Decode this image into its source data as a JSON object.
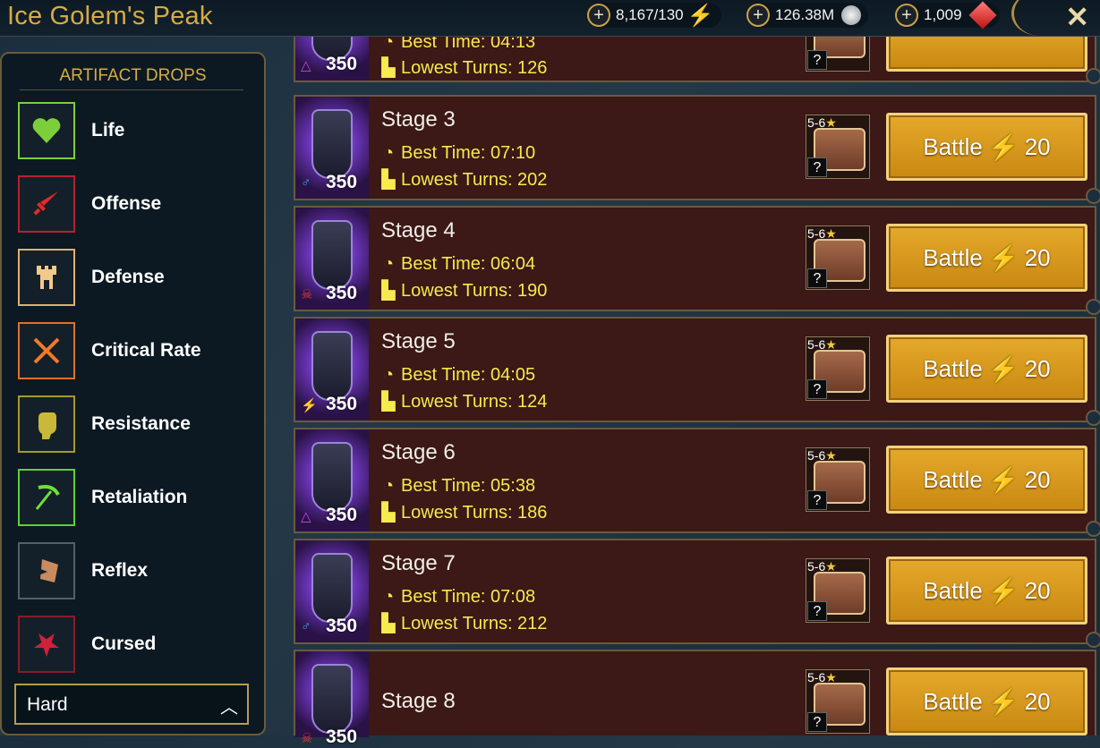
{
  "header": {
    "title": "Ice Golem's Peak",
    "resources": [
      {
        "name": "energy",
        "value": "8,167/130",
        "icon": "lightning-icon"
      },
      {
        "name": "silver",
        "value": "126.38M",
        "icon": "silver-coin-icon"
      },
      {
        "name": "gems",
        "value": "1,009",
        "icon": "ruby-icon"
      }
    ],
    "close_symbol": "✕"
  },
  "panel": {
    "title": "ARTIFACT DROPS",
    "filters": [
      {
        "label": "Life",
        "icon": "heart-icon",
        "color": "#7ccf3b"
      },
      {
        "label": "Offense",
        "icon": "sword-icon",
        "color": "#d23030"
      },
      {
        "label": "Defense",
        "icon": "tower-icon",
        "color": "#f0c57a"
      },
      {
        "label": "Critical Rate",
        "icon": "crossed-swords-icon",
        "color": "#f07a2a"
      },
      {
        "label": "Resistance",
        "icon": "fist-icon",
        "color": "#c9b83a"
      },
      {
        "label": "Retaliation",
        "icon": "scythe-icon",
        "color": "#6fe03a"
      },
      {
        "label": "Reflex",
        "icon": "arrow-shield-icon",
        "color": "#c98a60"
      },
      {
        "label": "Cursed",
        "icon": "pentagram-icon",
        "color": "#d0203a"
      }
    ],
    "difficulty": "Hard"
  },
  "stages": [
    {
      "name": "",
      "level": "350",
      "affinity": "triangle",
      "best_time": "Best Time: 04:13",
      "lowest_turns": "Lowest Turns: 126",
      "chest_rank": "5-6",
      "battle_label": "Battle",
      "battle_cost": "20"
    },
    {
      "name": "Stage 3",
      "level": "350",
      "affinity": "blue",
      "best_time": "Best Time: 07:10",
      "lowest_turns": "Lowest Turns: 202",
      "chest_rank": "5-6",
      "battle_label": "Battle",
      "battle_cost": "20"
    },
    {
      "name": "Stage 4",
      "level": "350",
      "affinity": "red",
      "best_time": "Best Time: 06:04",
      "lowest_turns": "Lowest Turns: 190",
      "chest_rank": "5-6",
      "battle_label": "Battle",
      "battle_cost": "20"
    },
    {
      "name": "Stage 5",
      "level": "350",
      "affinity": "green",
      "best_time": "Best Time: 04:05",
      "lowest_turns": "Lowest Turns: 124",
      "chest_rank": "5-6",
      "battle_label": "Battle",
      "battle_cost": "20"
    },
    {
      "name": "Stage 6",
      "level": "350",
      "affinity": "triangle",
      "best_time": "Best Time: 05:38",
      "lowest_turns": "Lowest Turns: 186",
      "chest_rank": "5-6",
      "battle_label": "Battle",
      "battle_cost": "20"
    },
    {
      "name": "Stage 7",
      "level": "350",
      "affinity": "blue",
      "best_time": "Best Time: 07:08",
      "lowest_turns": "Lowest Turns: 212",
      "chest_rank": "5-6",
      "battle_label": "Battle",
      "battle_cost": "20"
    },
    {
      "name": "Stage 8",
      "level": "350",
      "affinity": "red",
      "best_time": "",
      "lowest_turns": "",
      "chest_rank": "5-6",
      "battle_label": "Battle",
      "battle_cost": "20"
    }
  ]
}
